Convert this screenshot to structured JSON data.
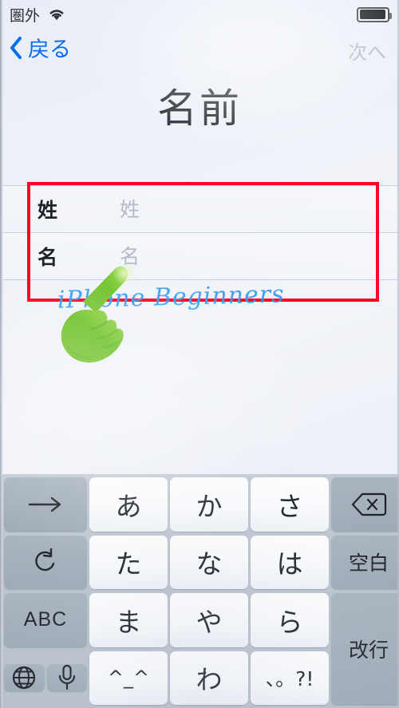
{
  "status_bar": {
    "carrier": "圏外",
    "wifi_icon": "wifi-icon",
    "battery_icon": "battery-icon",
    "battery_level_pct": 88
  },
  "nav_bar": {
    "back_label": "戻る",
    "back_icon": "chevron-left-icon",
    "next_label": "次へ",
    "next_enabled": false
  },
  "page": {
    "title": "名前"
  },
  "form": {
    "rows": [
      {
        "label": "姓",
        "value": "",
        "placeholder": "姓"
      },
      {
        "label": "名",
        "value": "",
        "placeholder": "名"
      }
    ]
  },
  "annotation": {
    "highlight_color": "#ff0026",
    "watermark_text": "iPhone Beginners",
    "watermark_color": "#2e9bee",
    "hand_cursor_icon": "pointing-hand-icon",
    "hand_cursor_color": "#64c42a"
  },
  "keyboard": {
    "type": "japanese-kana-10key",
    "rows": [
      [
        {
          "name": "arrow-right-key",
          "glyph": "→",
          "style": "dark",
          "kind": "sym"
        },
        {
          "name": "kana-a-key",
          "glyph": "あ",
          "style": "light",
          "kind": "kana"
        },
        {
          "name": "kana-ka-key",
          "glyph": "か",
          "style": "light",
          "kind": "kana"
        },
        {
          "name": "kana-sa-key",
          "glyph": "さ",
          "style": "light",
          "kind": "kana"
        },
        {
          "name": "delete-key",
          "glyph": "⌫",
          "style": "dark",
          "kind": "icon"
        }
      ],
      [
        {
          "name": "undo-key",
          "glyph": "↺",
          "style": "dark",
          "kind": "sym"
        },
        {
          "name": "kana-ta-key",
          "glyph": "た",
          "style": "light",
          "kind": "kana"
        },
        {
          "name": "kana-na-key",
          "glyph": "な",
          "style": "light",
          "kind": "kana"
        },
        {
          "name": "kana-ha-key",
          "glyph": "は",
          "style": "light",
          "kind": "kana"
        },
        {
          "name": "space-key",
          "glyph": "空白",
          "style": "dark",
          "kind": "label"
        }
      ],
      [
        {
          "name": "abc-key",
          "glyph": "ABC",
          "style": "dark",
          "kind": "abc"
        },
        {
          "name": "kana-ma-key",
          "glyph": "ま",
          "style": "light",
          "kind": "kana"
        },
        {
          "name": "kana-ya-key",
          "glyph": "や",
          "style": "light",
          "kind": "kana"
        },
        {
          "name": "kana-ra-key",
          "glyph": "ら",
          "style": "light",
          "kind": "kana"
        },
        {
          "name": "return-key",
          "glyph": "改行",
          "style": "dark",
          "kind": "label"
        }
      ],
      [
        {
          "name": "globe-key",
          "glyph": "🌐",
          "style": "dark",
          "kind": "icon"
        },
        {
          "name": "dictation-key",
          "glyph": "🎤",
          "style": "dark",
          "kind": "icon"
        },
        {
          "name": "emoticon-key",
          "glyph": "^_^",
          "style": "light",
          "kind": "sym"
        },
        {
          "name": "kana-wa-key",
          "glyph": "わ",
          "style": "light",
          "kind": "kana"
        },
        {
          "name": "punctuation-key",
          "glyph": "、。?!",
          "style": "light",
          "kind": "punct"
        }
      ]
    ]
  }
}
